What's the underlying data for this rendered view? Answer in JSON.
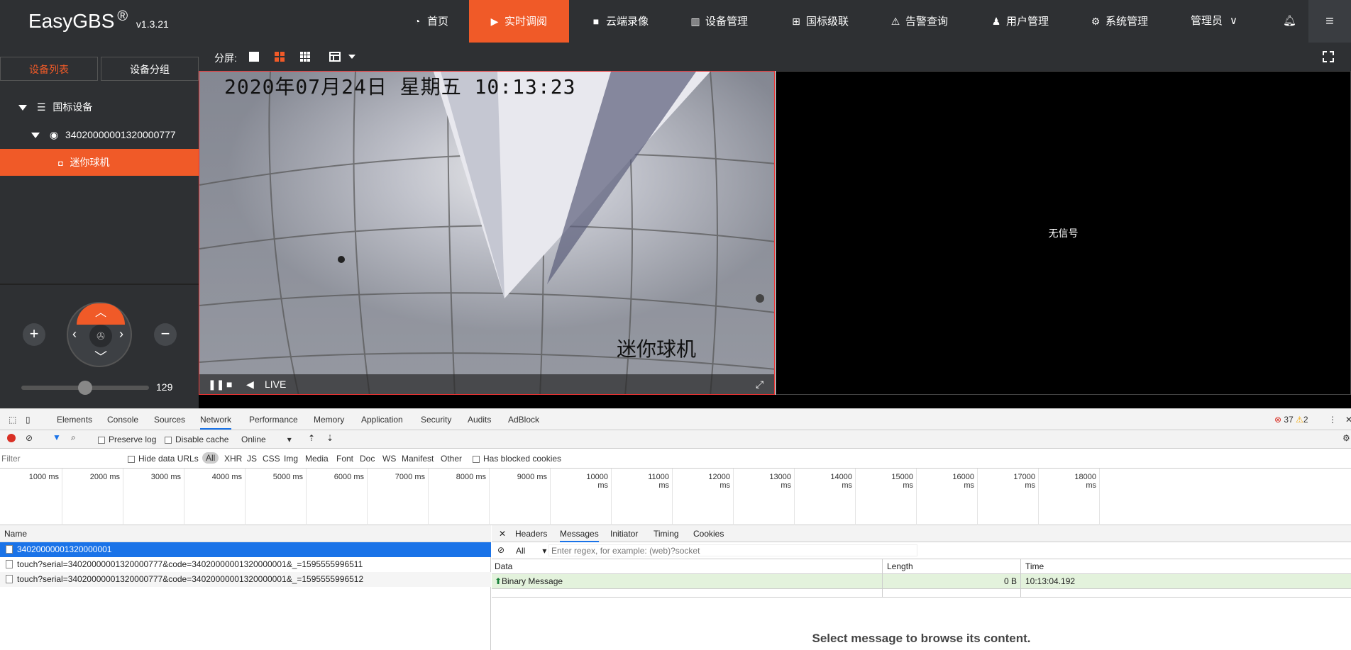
{
  "app": {
    "name": "EasyGBS",
    "reg": "®",
    "version": "v1.3.21"
  },
  "nav": {
    "items": [
      {
        "label": "首页",
        "icon": "dashboard-icon"
      },
      {
        "label": "实时调阅",
        "icon": "play-circle-icon",
        "active": true
      },
      {
        "label": "云端录像",
        "icon": "video-camera-icon"
      },
      {
        "label": "设备管理",
        "icon": "book-icon"
      },
      {
        "label": "国标级联",
        "icon": "link-icon"
      },
      {
        "label": "告警查询",
        "icon": "alarm-icon"
      },
      {
        "label": "用户管理",
        "icon": "user-icon"
      },
      {
        "label": "系统管理",
        "icon": "gear-icon"
      }
    ],
    "user": "管理员"
  },
  "left": {
    "tabs": [
      "设备列表",
      "设备分组"
    ],
    "tree": {
      "root": "国标设备",
      "device": "34020000001320000777",
      "channel": "迷你球机"
    },
    "ptz": {
      "speed": "129",
      "speed_fraction": 0.5
    }
  },
  "split": {
    "label": "分屏:"
  },
  "video": {
    "osd_time": "2020年07月24日  星期五  10:13:23",
    "osd_camera": "迷你球机",
    "live_label": "LIVE",
    "no_signal": "无信号"
  },
  "devtools": {
    "tabs": [
      "Elements",
      "Console",
      "Sources",
      "Network",
      "Performance",
      "Memory",
      "Application",
      "Security",
      "Audits",
      "AdBlock"
    ],
    "active_tab": "Network",
    "errors": "37",
    "warnings": "2",
    "toolbar": {
      "preserve_log": "Preserve log",
      "disable_cache": "Disable cache",
      "throttle": "Online"
    },
    "filter": {
      "placeholder": "Filter",
      "hide_data_urls": "Hide data URLs",
      "types": [
        "All",
        "XHR",
        "JS",
        "CSS",
        "Img",
        "Media",
        "Font",
        "Doc",
        "WS",
        "Manifest",
        "Other"
      ],
      "blocked": "Has blocked cookies"
    },
    "timeline": [
      "1000 ms",
      "2000 ms",
      "3000 ms",
      "4000 ms",
      "5000 ms",
      "6000 ms",
      "7000 ms",
      "8000 ms",
      "9000 ms",
      "10000 ms",
      "11000 ms",
      "12000 ms",
      "13000 ms",
      "14000 ms",
      "15000 ms",
      "16000 ms",
      "17000 ms",
      "18000 ms"
    ],
    "requests": {
      "header": "Name",
      "rows": [
        "34020000001320000001",
        "touch?serial=34020000001320000777&code=34020000001320000001&_=1595555996511",
        "touch?serial=34020000001320000777&code=34020000001320000001&_=1595555996512"
      ]
    },
    "detail": {
      "tabs": [
        "Headers",
        "Messages",
        "Initiator",
        "Timing",
        "Cookies"
      ],
      "active_tab": "Messages",
      "filter_select": "All",
      "filter_placeholder": "Enter regex, for example: (web)?socket",
      "columns": [
        "Data",
        "Length",
        "Time"
      ],
      "message": {
        "data": "Binary Message",
        "length": "0 B",
        "time": "10:13:04.192"
      },
      "empty_text": "Select message to browse its content."
    }
  }
}
